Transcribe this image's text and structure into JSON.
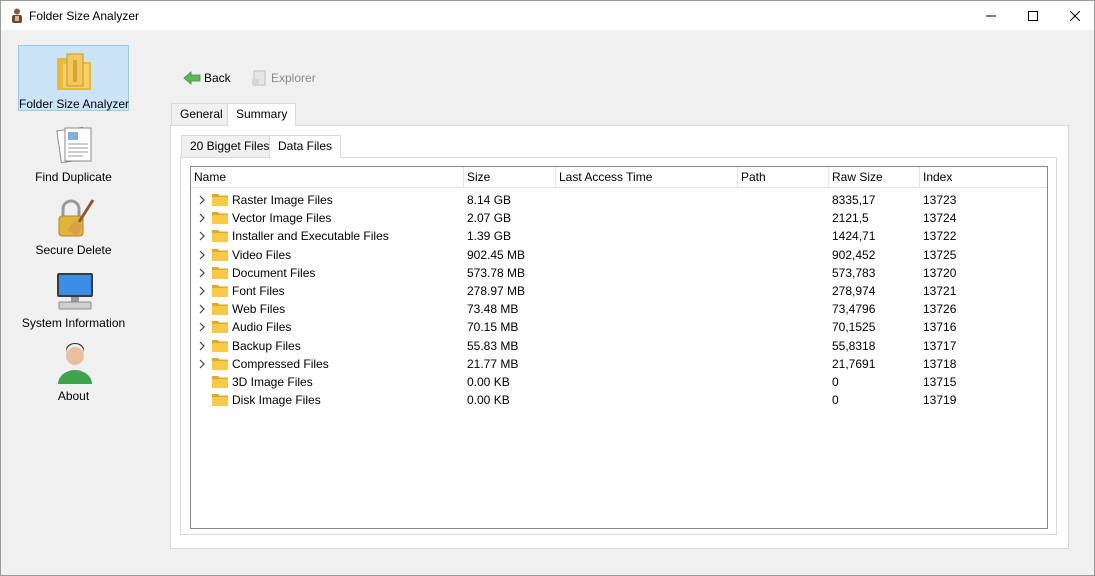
{
  "window": {
    "title": "Folder Size Analyzer"
  },
  "sidebar": {
    "items": [
      {
        "label": "Folder Size Analyzer",
        "icon": "folder-icon",
        "active": true
      },
      {
        "label": "Find Duplicate",
        "icon": "documents-icon",
        "active": false
      },
      {
        "label": "Secure Delete",
        "icon": "lock-broom-icon",
        "active": false
      },
      {
        "label": "System Information",
        "icon": "computer-icon",
        "active": false
      },
      {
        "label": "About",
        "icon": "user-icon",
        "active": false
      }
    ]
  },
  "toolbar": {
    "back_label": "Back",
    "explorer_label": "Explorer"
  },
  "tabs": {
    "general": "General",
    "summary": "Summary"
  },
  "subtabs": {
    "biggest": "20 Bigget Files",
    "data": "Data Files"
  },
  "grid": {
    "columns": [
      "Name",
      "Size",
      "Last Access Time",
      "Path",
      "Raw Size",
      "Index"
    ],
    "rows": [
      {
        "name": "Raster Image Files",
        "size": "8.14 GB",
        "last_access": "",
        "path": "",
        "raw_size": "8335,17",
        "index": "13723",
        "expandable": true
      },
      {
        "name": "Vector Image Files",
        "size": "2.07 GB",
        "last_access": "",
        "path": "",
        "raw_size": "2121,5",
        "index": "13724",
        "expandable": true
      },
      {
        "name": "Installer and Executable Files",
        "size": "1.39 GB",
        "last_access": "",
        "path": "",
        "raw_size": "1424,71",
        "index": "13722",
        "expandable": true
      },
      {
        "name": "Video Files",
        "size": "902.45 MB",
        "last_access": "",
        "path": "",
        "raw_size": "902,452",
        "index": "13725",
        "expandable": true
      },
      {
        "name": "Document Files",
        "size": "573.78 MB",
        "last_access": "",
        "path": "",
        "raw_size": "573,783",
        "index": "13720",
        "expandable": true
      },
      {
        "name": "Font Files",
        "size": "278.97 MB",
        "last_access": "",
        "path": "",
        "raw_size": "278,974",
        "index": "13721",
        "expandable": true
      },
      {
        "name": "Web Files",
        "size": "73.48 MB",
        "last_access": "",
        "path": "",
        "raw_size": "73,4796",
        "index": "13726",
        "expandable": true
      },
      {
        "name": "Audio Files",
        "size": "70.15 MB",
        "last_access": "",
        "path": "",
        "raw_size": "70,1525",
        "index": "13716",
        "expandable": true
      },
      {
        "name": "Backup Files",
        "size": "55.83 MB",
        "last_access": "",
        "path": "",
        "raw_size": "55,8318",
        "index": "13717",
        "expandable": true
      },
      {
        "name": "Compressed Files",
        "size": "21.77 MB",
        "last_access": "",
        "path": "",
        "raw_size": "21,7691",
        "index": "13718",
        "expandable": true
      },
      {
        "name": "3D Image Files",
        "size": "0.00 KB",
        "last_access": "",
        "path": "",
        "raw_size": "0",
        "index": "13715",
        "expandable": false
      },
      {
        "name": "Disk Image Files",
        "size": "0.00 KB",
        "last_access": "",
        "path": "",
        "raw_size": "0",
        "index": "13719",
        "expandable": false
      }
    ]
  },
  "colors": {
    "selection_bg": "#cce4f7",
    "selection_border": "#99c9ef",
    "folder": "#f7c948"
  }
}
